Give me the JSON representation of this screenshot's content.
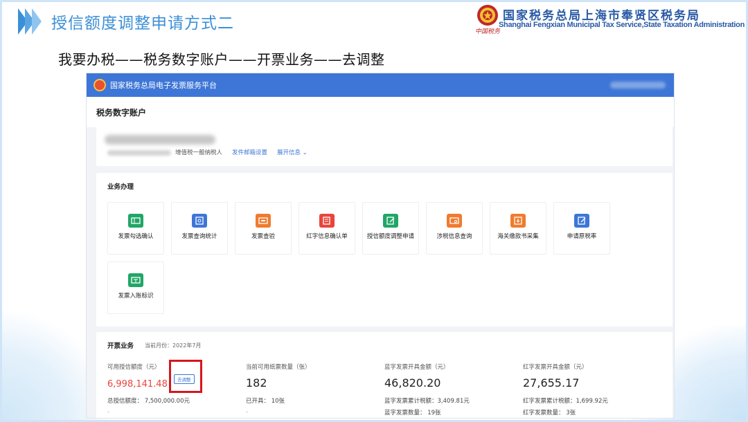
{
  "slide": {
    "title": "授信额度调整申请方式二",
    "org_name_cn": "国家税务总局上海市奉贤区税务局",
    "org_name_en": "Shanghai Fengxian Municipal Tax Service,State Taxation Administration",
    "org_signature": "中国税务",
    "breadcrumb": "我要办税——税务数字账户——开票业务——去调整"
  },
  "app": {
    "platform_title": "国家税务总局电子发票服务平台",
    "page_title": "税务数字账户"
  },
  "account": {
    "taxpayer_type": "增值税一般纳税人",
    "mail_settings_link": "发件邮箱设置",
    "expand_info_link": "展开信息"
  },
  "business": {
    "section_title": "业务办理",
    "tiles": [
      {
        "label": "发票勾选确认",
        "icon": "ticket-icon",
        "color": "#21a667"
      },
      {
        "label": "发票查询统计",
        "icon": "search-doc-icon",
        "color": "#3d76d6"
      },
      {
        "label": "发票查验",
        "icon": "verify-ticket-icon",
        "color": "#f07b2e"
      },
      {
        "label": "红字信息确认单",
        "icon": "red-doc-icon",
        "color": "#e8453c"
      },
      {
        "label": "授信额度调整申请",
        "icon": "edit-doc-icon",
        "color": "#21a667"
      },
      {
        "label": "涉税信息查询",
        "icon": "card-search-icon",
        "color": "#f07b2e"
      },
      {
        "label": "海关缴款书采集",
        "icon": "download-doc-icon",
        "color": "#f07b2e"
      },
      {
        "label": "申请原税率",
        "icon": "edit-page-icon",
        "color": "#3d76d6"
      },
      {
        "label": "发票入账标识",
        "icon": "ticket-mark-icon",
        "color": "#21a667"
      }
    ]
  },
  "invoicing": {
    "section_title": "开票业务",
    "current_month": "当前月份：2022年7月",
    "credit": {
      "label": "可用授信额度（元）",
      "value": "6,998,141.48",
      "adjust_label": "去调整",
      "total_label": "总授信额度：",
      "total_value": "7,500,000.00元",
      "dash": "-"
    },
    "paper": {
      "label": "当前可用纸票数量（张）",
      "value": "182",
      "issued_label": "已开具：",
      "issued_value": "10张",
      "dash": "-"
    },
    "blue": {
      "label": "蓝字发票开具金额（元）",
      "value": "46,820.20",
      "tax_label": "蓝字发票累计税额：",
      "tax_value": "3,409.81元",
      "count_label": "蓝字发票数量：",
      "count_value": "19张"
    },
    "red": {
      "label": "红字发票开具金额（元）",
      "value": "27,655.17",
      "tax_label": "红字发票累计税额：",
      "tax_value": "1,699.92元",
      "count_label": "红字发票数量：",
      "count_value": "3张"
    }
  }
}
